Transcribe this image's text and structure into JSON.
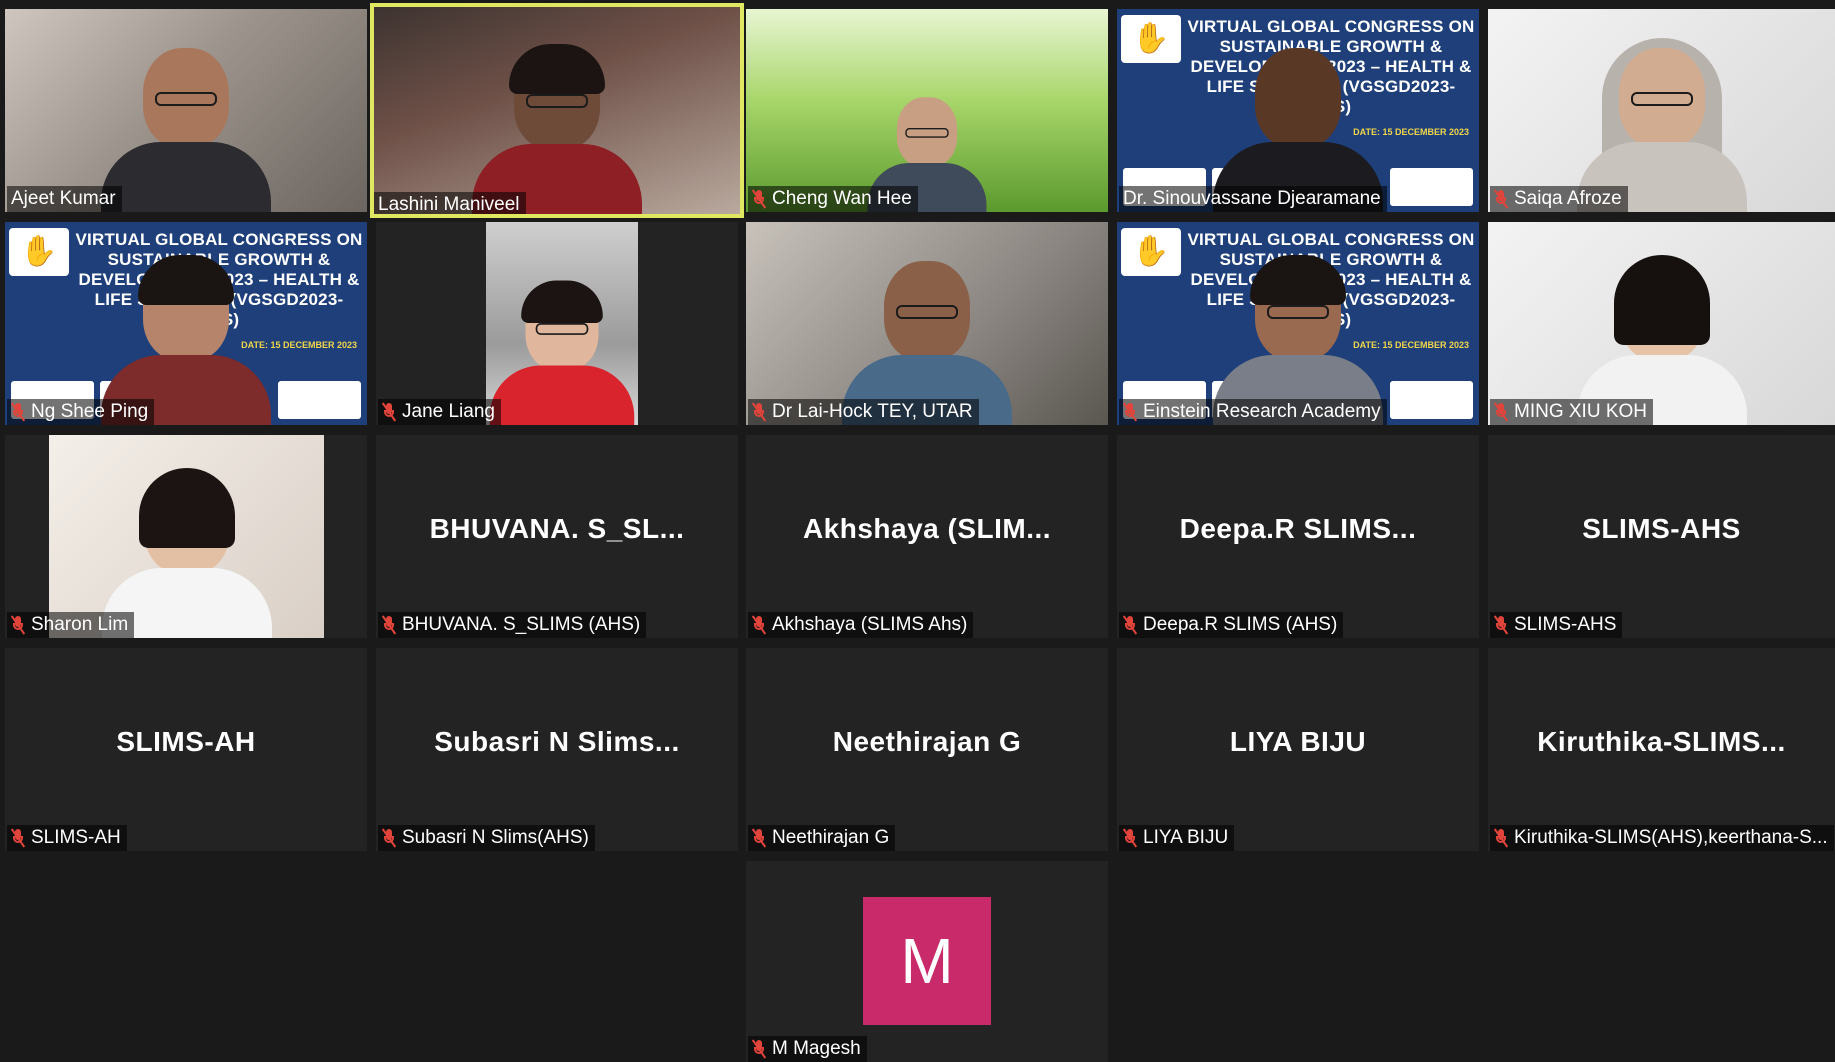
{
  "banner": {
    "text": "VIRTUAL GLOBAL CONGRESS ON SUSTAINABLE GROWTH & DEVELOPMENT 2023 – HEALTH & LIFE SCIENCES (VGSGD2023-HLS)",
    "date": "DATE: 15 DECEMBER 2023"
  },
  "participants": [
    {
      "name": "Ajeet Kumar",
      "muted": false,
      "video": true
    },
    {
      "name": "Lashini Maniveel",
      "muted": false,
      "video": true,
      "speaking": true
    },
    {
      "name": "Cheng Wan Hee",
      "muted": true,
      "video": true
    },
    {
      "name": "Dr. Sinouvassane Djearamane",
      "muted": false,
      "video": true
    },
    {
      "name": "Saiqa Afroze",
      "muted": true,
      "video": true
    },
    {
      "name": "Ng Shee Ping",
      "muted": true,
      "video": true
    },
    {
      "name": "Jane Liang",
      "muted": true,
      "video": true
    },
    {
      "name": "Dr Lai-Hock TEY, UTAR",
      "muted": true,
      "video": true
    },
    {
      "name": "Einstein Research Academy",
      "muted": true,
      "video": true
    },
    {
      "name": "MING XIU KOH",
      "muted": true,
      "video": true
    },
    {
      "name": "Sharon Lim",
      "muted": true,
      "video": true
    },
    {
      "name": "BHUVANA. S_SLIMS (AHS)",
      "display": "BHUVANA. S_SL...",
      "muted": true,
      "video": false
    },
    {
      "name": "Akhshaya (SLIMS Ahs)",
      "display": "Akhshaya (SLIM...",
      "muted": true,
      "video": false
    },
    {
      "name": "Deepa.R SLIMS (AHS)",
      "display": "Deepa.R SLIMS...",
      "muted": true,
      "video": false
    },
    {
      "name": "SLIMS-AHS",
      "display": "SLIMS-AHS",
      "muted": true,
      "video": false
    },
    {
      "name": "SLIMS-AH",
      "display": "SLIMS-AH",
      "muted": true,
      "video": false
    },
    {
      "name": "Subasri N Slims(AHS)",
      "display": "Subasri N Slims...",
      "muted": true,
      "video": false
    },
    {
      "name": "Neethirajan G",
      "display": "Neethirajan G",
      "muted": true,
      "video": false
    },
    {
      "name": "LIYA BIJU",
      "display": "LIYA BIJU",
      "muted": true,
      "video": false
    },
    {
      "name": "Kiruthika-SLIMS(AHS),keerthana-S...",
      "display": "Kiruthika-SLIMS...",
      "muted": true,
      "video": false
    },
    {
      "name": "M Magesh",
      "avatar": "M",
      "avatar_color": "#c92a6a",
      "muted": true,
      "video": false
    }
  ],
  "colors": {
    "background": "#1a1a1a",
    "tile": "#232323",
    "speaking_border": "#dfe860",
    "muted_icon": "#e0443a",
    "banner": "#1e3f7a"
  }
}
